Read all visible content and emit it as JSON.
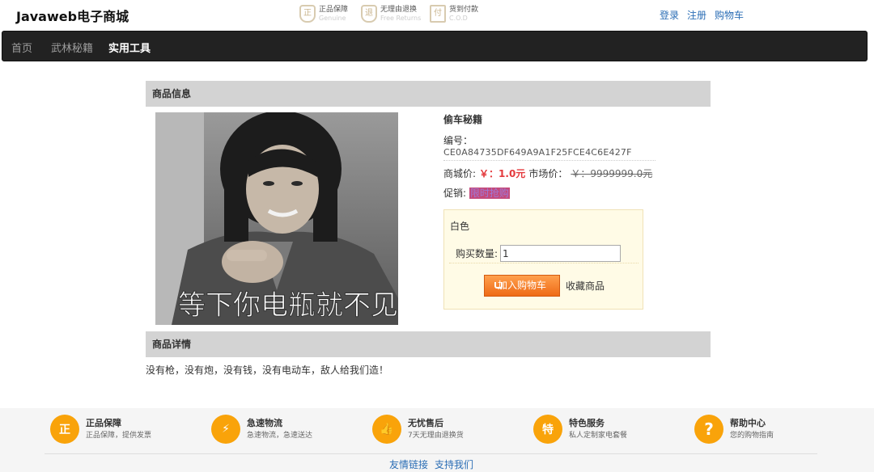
{
  "header": {
    "brand": "Javaweb电子商城",
    "promises": [
      {
        "icon": "shield-icon",
        "glyph": "正",
        "title": "正品保障",
        "sub": "Genuine"
      },
      {
        "icon": "return-icon",
        "glyph": "退",
        "title": "无理由退换",
        "sub": "Free Returns"
      },
      {
        "icon": "cod-icon",
        "glyph": "付",
        "title": "货到付款",
        "sub": "C.O.D"
      }
    ],
    "links": [
      "登录",
      "注册",
      "购物车"
    ]
  },
  "nav": {
    "items": [
      "首页",
      "武林秘籍",
      "实用工具"
    ],
    "active": "实用工具"
  },
  "product": {
    "section_title": "商品信息",
    "image_caption": "等下你电瓶就不见",
    "name": "偷车秘籍",
    "number_label": "编号：",
    "number": "CE0A84735DF649A9A1F25FCE4C6E427F",
    "price_label": "商城价:",
    "price": "￥：1.0元",
    "market_label": "市场价：",
    "market_price": "￥：9999999.0元",
    "promo_label": "促销:",
    "promo_tag": "限时抢购",
    "color": "白色",
    "qty_label": "购买数量:",
    "qty_value": "1",
    "cart_button": "加入购物车",
    "favorite": "收藏商品"
  },
  "details": {
    "section_title": "商品详情",
    "text": "没有枪，没有炮，没有钱，没有电动车，敌人给我们造！"
  },
  "footer": {
    "features": [
      {
        "icon": "genuine-icon",
        "glyph": "正",
        "title": "正品保障",
        "sub": "正品保障，提供发票"
      },
      {
        "icon": "express-icon",
        "glyph": "⚡",
        "title": "急速物流",
        "sub": "急速物流，急速送达"
      },
      {
        "icon": "thumbs-up-icon",
        "glyph": "👍",
        "title": "无忧售后",
        "sub": "7天无理由退换货"
      },
      {
        "icon": "special-icon",
        "glyph": "特",
        "title": "特色服务",
        "sub": "私人定制家电套餐"
      },
      {
        "icon": "help-icon",
        "glyph": "?",
        "title": "帮助中心",
        "sub": "您的购物指南"
      }
    ],
    "links": [
      "友情链接",
      "支持我们"
    ]
  },
  "colors": {
    "accent": "#e4393c",
    "nav_bg": "#222222",
    "section_bg": "#d3d3d3",
    "footer_icon": "#f9a30a",
    "cart_button": "#ee6a16"
  }
}
